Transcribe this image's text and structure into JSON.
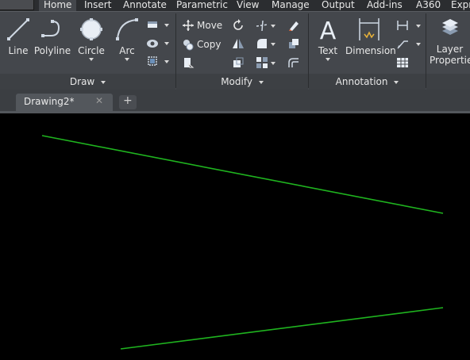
{
  "ribbon_tabs": [
    "Home",
    "Insert",
    "Annotate",
    "Parametric",
    "View",
    "Manage",
    "Output",
    "Add-ins",
    "A360",
    "Expr"
  ],
  "draw_panel": {
    "title": "Draw",
    "line": "Line",
    "polyline": "Polyline",
    "circle": "Circle",
    "arc": "Arc"
  },
  "modify_panel": {
    "title": "Modify",
    "move": "Move",
    "copy": "Copy"
  },
  "annotation_panel": {
    "title": "Annotation",
    "text": "Text",
    "dimension": "Dimension"
  },
  "layers_panel": {
    "layer_properties_1": "Layer",
    "layer_properties_2": "Properties"
  },
  "document": {
    "tab_title": "Drawing2*",
    "close_glyph": "✕",
    "new_tab_glyph": "+"
  },
  "drawing": {
    "line_color": "#1fb41f",
    "background": "#000000"
  }
}
